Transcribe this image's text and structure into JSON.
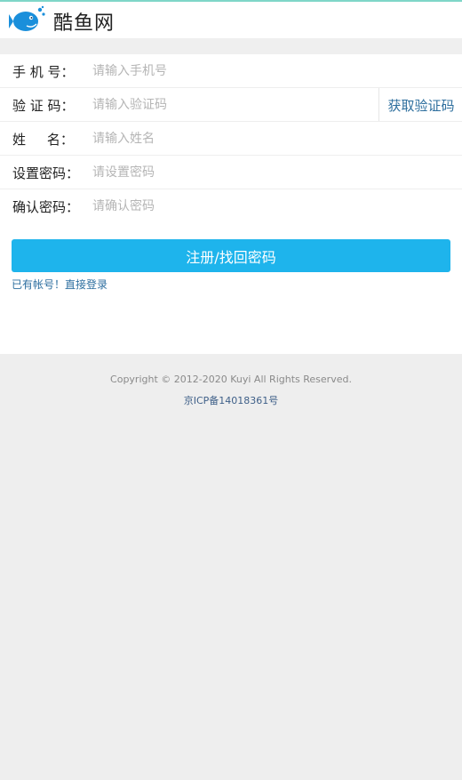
{
  "header": {
    "site_name": "酷鱼网"
  },
  "form": {
    "phone": {
      "label": "手 机 号：",
      "placeholder": "请输入手机号"
    },
    "code": {
      "label": "验 证 码：",
      "placeholder": "请输入验证码",
      "button": "获取验证码"
    },
    "name": {
      "label": "姓     名：",
      "placeholder": "请输入姓名"
    },
    "password": {
      "label": "设置密码：",
      "placeholder": "请设置密码"
    },
    "confirm": {
      "label": "确认密码：",
      "placeholder": "请确认密码"
    },
    "submit_label": "注册/找回密码",
    "login_link": "已有帐号！直接登录"
  },
  "footer": {
    "copyright": "Copyright © 2012-2020 Kuyi All Rights Reserved.",
    "icp": "京ICP备14018361号"
  },
  "colors": {
    "accent": "#1eb4ec",
    "link": "#2c6e9f",
    "logo": "#1a8fdb"
  },
  "icons": {
    "logo": "fish-logo-icon"
  }
}
